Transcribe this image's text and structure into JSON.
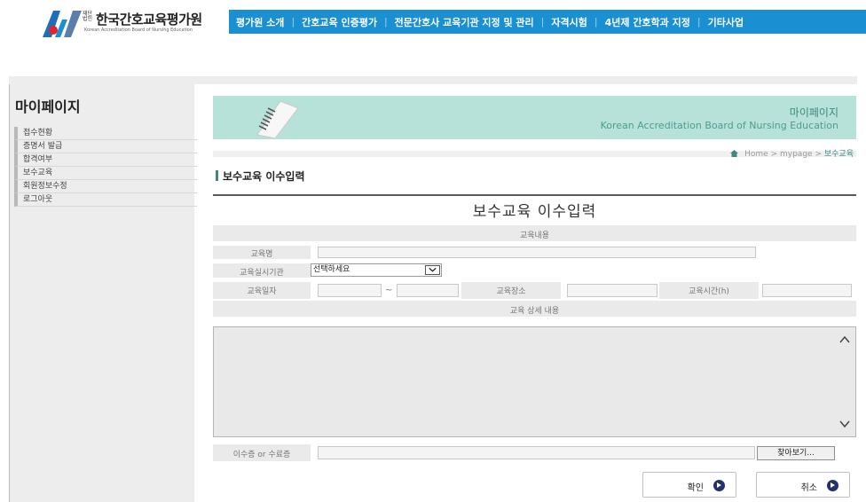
{
  "header": {
    "logo_small": "재단\n법인",
    "logo_title": "한국간호교육평가원",
    "logo_sub": "Korean Accreditation Board of Nursing Education",
    "nav": [
      "평가원 소개",
      "간호교육 인증평가",
      "전문간호사 교육기관 지정 및 관리",
      "자격시험",
      "4년제 간호학과 지정",
      "기타사업"
    ],
    "brand_color": "#1a8fd1"
  },
  "sidebar": {
    "title": "마이페이지",
    "items": [
      "접수현황",
      "증명서 발급",
      "합격여부",
      "보수교육",
      "회원정보수정",
      "로그아웃"
    ]
  },
  "banner": {
    "title": "마이페이지",
    "subtitle": "Korean Accreditation Board of Nursing Education",
    "color": "#b7e2d9"
  },
  "breadcrumb": {
    "home": "Home",
    "sep1": ">",
    "mid": "mypage",
    "sep2": ">",
    "current": "보수교육"
  },
  "page_heading": "보수교육 이수입력",
  "form": {
    "title": "보수교육 이수입력",
    "section_header": "교육내용",
    "label_course_name": "교육명",
    "label_institution": "교육실시기관",
    "institution_selected": "선택하세요",
    "label_date": "교육일자",
    "tilde": "~",
    "label_place": "교육장소",
    "label_hours": "교육시간(h)",
    "detail_header": "교육 상세 내용",
    "label_certificate": "이수증 or 수료증",
    "browse_label": "찾아보기..."
  },
  "buttons": {
    "confirm": "확인",
    "cancel": "취소"
  }
}
